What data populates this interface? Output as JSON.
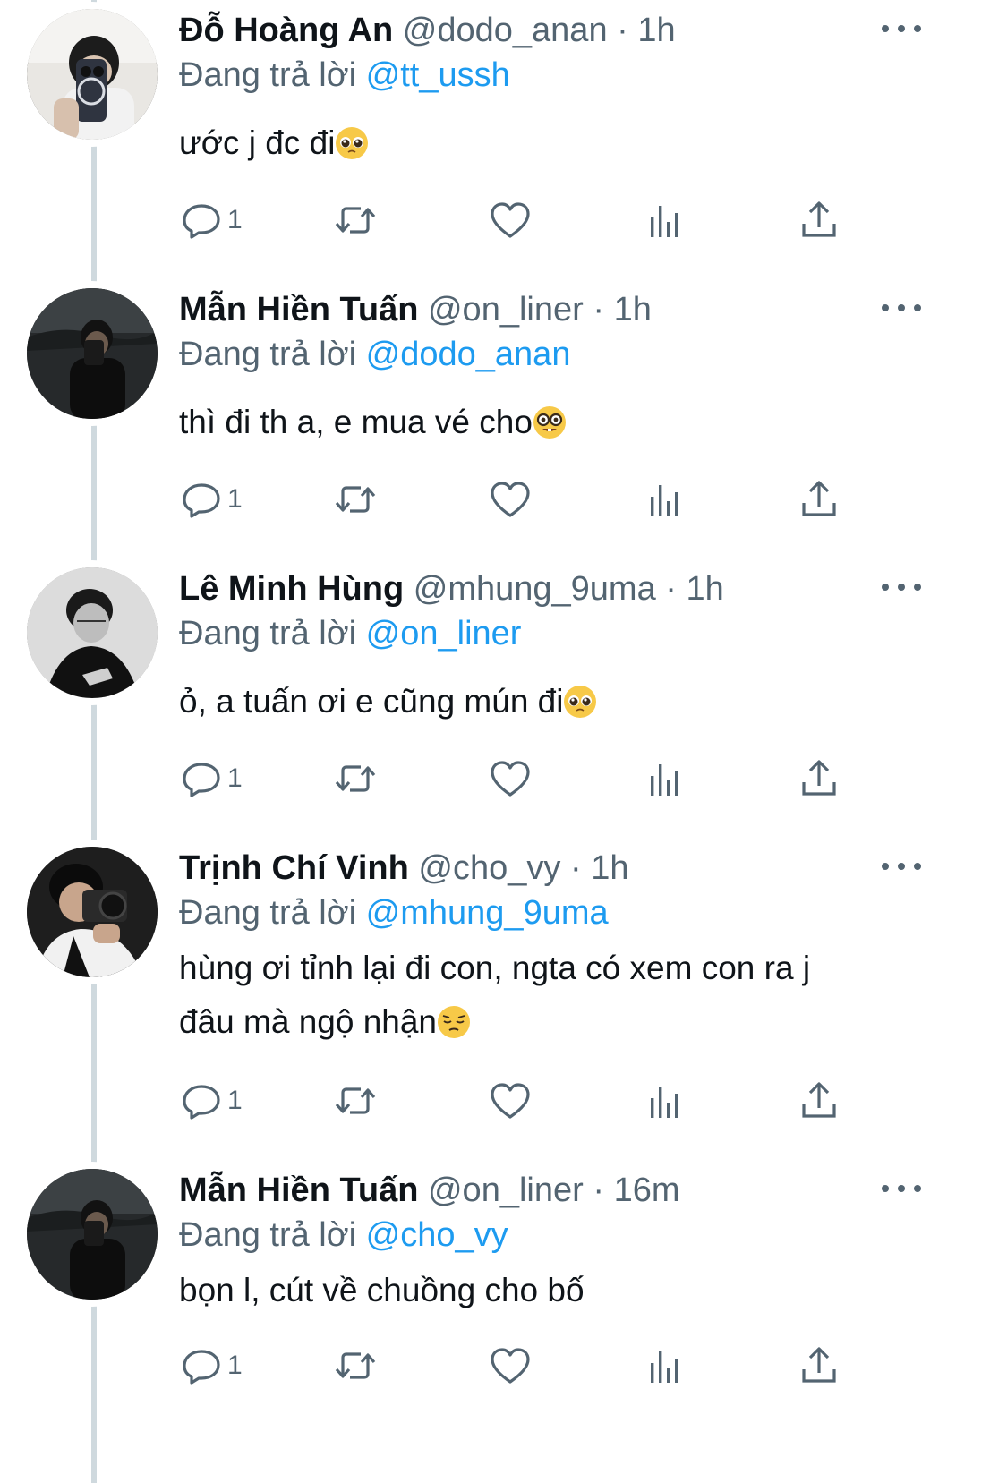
{
  "colors": {
    "link": "#1d9bf0",
    "secondary": "#536471",
    "text": "#0f1419",
    "thread_line": "#cfd9de"
  },
  "replying_prefix": "Đang trả lời",
  "tweets": [
    {
      "name": "Đỗ Hoàng An",
      "handle": "@dodo_anan",
      "sep": "·",
      "time": "1h",
      "reply_to": "@tt_ussh",
      "text_lines": [
        "ước j đc đi"
      ],
      "emoji": "pleading-face",
      "reply_count": "1"
    },
    {
      "name": "Mẫn Hiền Tuấn",
      "handle": "@on_liner",
      "sep": "·",
      "time": "1h",
      "reply_to": "@dodo_anan",
      "text_lines": [
        "thì đi th a, e mua vé cho"
      ],
      "emoji": "nerd-face",
      "reply_count": "1"
    },
    {
      "name": "Lê Minh Hùng",
      "handle": "@mhung_9uma",
      "sep": "·",
      "time": "1h",
      "reply_to": "@on_liner",
      "text_lines": [
        "ỏ, a tuấn ơi e cũng mún đi"
      ],
      "emoji": "pleading-face",
      "reply_count": "1"
    },
    {
      "name": "Trịnh Chí Vinh",
      "handle": "@cho_vy",
      "sep": "·",
      "time": "1h",
      "reply_to": "@mhung_9uma",
      "text_lines": [
        "hùng ơi tỉnh lại đi con, ngta có xem con ra j",
        "đâu mà ngộ nhận"
      ],
      "emoji": "pensive-face",
      "reply_count": "1"
    },
    {
      "name": "Mẫn Hiền Tuấn",
      "handle": "@on_liner",
      "sep": "·",
      "time": "16m",
      "reply_to": "@cho_vy",
      "text_lines": [
        "bọn l, cút về chuồng cho bố"
      ],
      "emoji": "",
      "reply_count": "1"
    }
  ],
  "icons": {
    "reply": "reply-icon",
    "retweet": "retweet-icon",
    "like": "heart-icon",
    "views": "views-icon",
    "share": "share-icon",
    "more": "more-dots-icon"
  }
}
